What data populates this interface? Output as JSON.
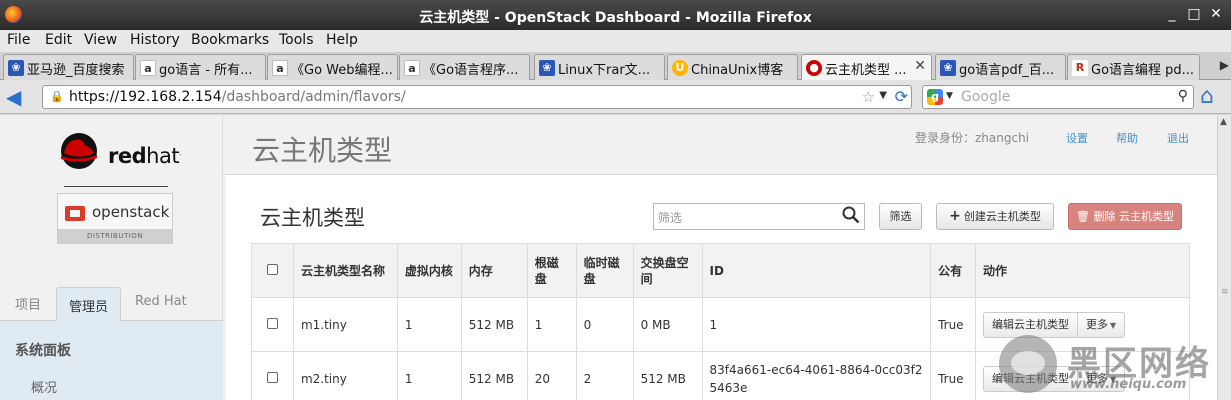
{
  "window": {
    "title": "云主机类型 - OpenStack Dashboard - Mozilla Firefox"
  },
  "menu": [
    "File",
    "Edit",
    "View",
    "History",
    "Bookmarks",
    "Tools",
    "Help"
  ],
  "tabs": [
    {
      "label": "亚马逊_百度搜索",
      "icon": "paw"
    },
    {
      "label": "go语言 - 所有...",
      "icon": "amazon"
    },
    {
      "label": "《Go Web编程...",
      "icon": "amazon"
    },
    {
      "label": "《Go语言程序...",
      "icon": "amazon"
    },
    {
      "label": "Linux下rar文...",
      "icon": "paw"
    },
    {
      "label": "ChinaUnix博客",
      "icon": "chinaunix"
    },
    {
      "label": "云主机类型 ...",
      "icon": "redhat",
      "active": true
    },
    {
      "label": "go语言pdf_百...",
      "icon": "paw"
    },
    {
      "label": "Go语言编程 pd...",
      "icon": "rb"
    }
  ],
  "nav": {
    "url_host": "https://192.168.2.154",
    "url_path": "/dashboard/admin/flavors/",
    "search_placeholder": "Google"
  },
  "sidebar": {
    "brand": {
      "red": "red",
      "hat": "hat"
    },
    "product": "openstack",
    "distribution": "DISTRIBUTION",
    "tabs": [
      "项目",
      "管理员",
      "Red Hat"
    ],
    "panel_heading": "系统面板",
    "panel_item": "概况"
  },
  "header": {
    "page_title": "云主机类型",
    "user_label": "登录身份：zhangchi",
    "links": [
      "设置",
      "帮助",
      "退出"
    ]
  },
  "table": {
    "title": "云主机类型",
    "filter_placeholder": "筛选",
    "filter_button": "筛选",
    "create_button": "创建云主机类型",
    "delete_button": "删除 云主机类型",
    "columns": [
      "",
      "云主机类型名称",
      "虚拟内核",
      "内存",
      "根磁盘",
      "临时磁盘",
      "交换盘空间",
      "ID",
      "公有",
      "动作"
    ],
    "rows": [
      {
        "name": "m1.tiny",
        "vcpus": "1",
        "ram": "512 MB",
        "root": "1",
        "ephemeral": "0",
        "swap": "0 MB",
        "id": "1",
        "public": "True"
      },
      {
        "name": "m2.tiny",
        "vcpus": "1",
        "ram": "512 MB",
        "root": "20",
        "ephemeral": "2",
        "swap": "512 MB",
        "id": "83f4a661-ec64-4061-8864-0cc03f25463e",
        "public": "True"
      }
    ],
    "row_edit": "编辑云主机类型",
    "row_more": "更多"
  },
  "watermark": {
    "text": "黑区网络",
    "url": "www.heiqu.com"
  },
  "colors": {
    "danger": "#d9837e",
    "link": "#4a8fcf",
    "panel": "#dfeaf3"
  }
}
